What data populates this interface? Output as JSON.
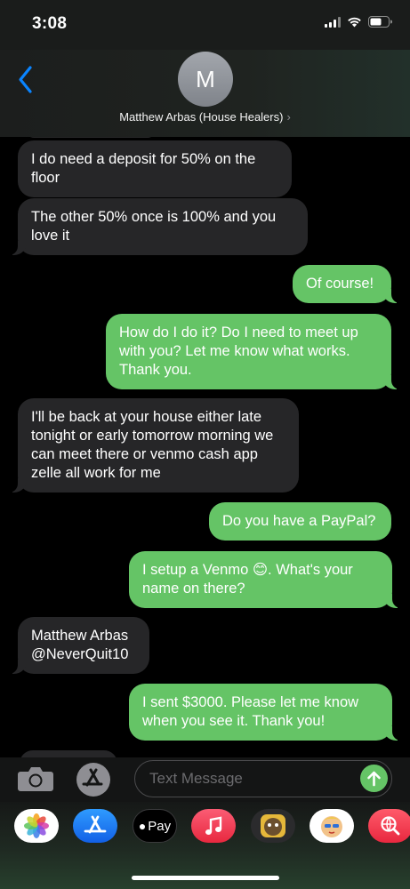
{
  "status_bar": {
    "time": "3:08"
  },
  "header": {
    "avatar_initial": "M",
    "contact_name": "Matthew Arbas (House Healers)",
    "chevron": "›"
  },
  "messages": [
    {
      "direction": "incoming",
      "text": "I do need a deposit for 50% on the floor"
    },
    {
      "direction": "incoming",
      "text": "The other 50% once is 100% and you love it"
    },
    {
      "direction": "outgoing",
      "text": "Of course!"
    },
    {
      "direction": "outgoing",
      "text": "How do I do it? Do I need to meet up with you? Let me know what works. Thank you."
    },
    {
      "direction": "incoming",
      "text": "I'll be back at your house either late tonight or early tomorrow morning we can meet there or venmo cash app zelle all work for me"
    },
    {
      "direction": "outgoing",
      "text": "Do you have a PayPal?"
    },
    {
      "direction": "outgoing",
      "text": "I setup a Venmo 😊. What's your name on there?"
    },
    {
      "direction": "incoming",
      "text": "Matthew Arbas @NeverQuit10"
    },
    {
      "direction": "outgoing",
      "text": "I sent $3000. Please let me know when you see it. Thank you!"
    }
  ],
  "input": {
    "placeholder": "Text Message"
  },
  "app_drawer": {
    "apple_pay_label": "Pay",
    "apps": [
      "photos-app",
      "app-store-app",
      "apple-pay-app",
      "music-app",
      "memoji-app",
      "memoji-stickers-app",
      "web-search-app"
    ]
  },
  "colors": {
    "outgoing_bubble": "#65c466",
    "incoming_bubble": "#262628",
    "accent_blue": "#0a84ff"
  }
}
